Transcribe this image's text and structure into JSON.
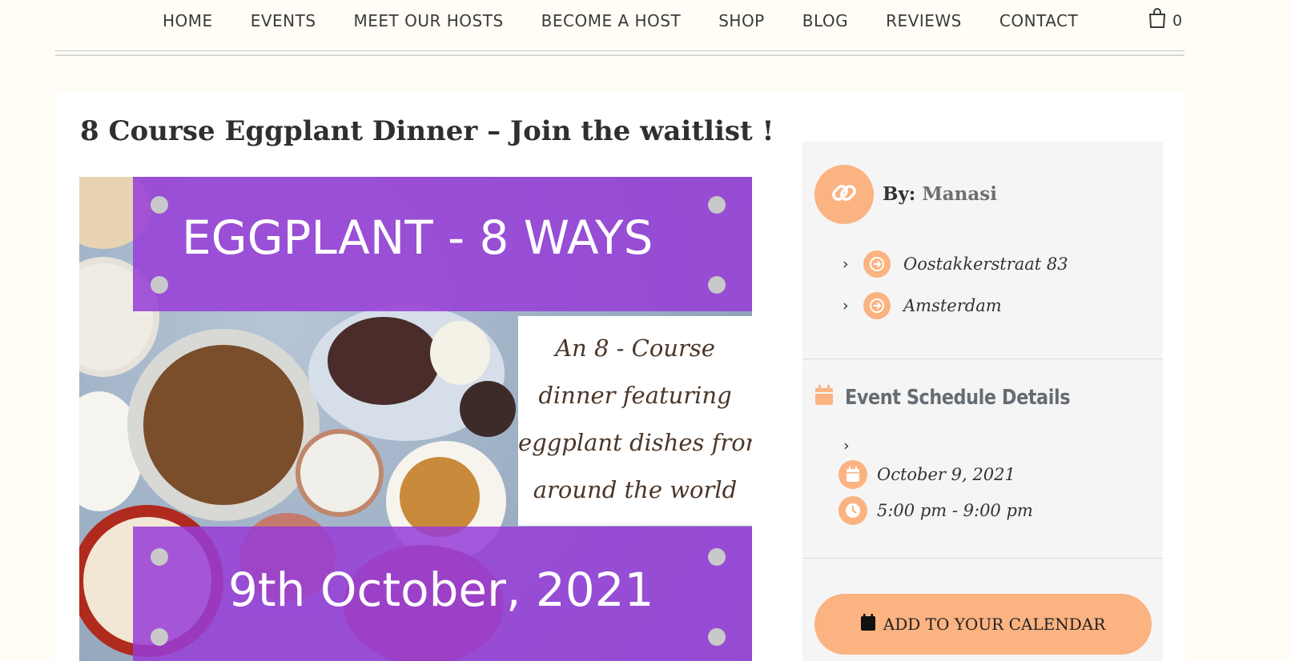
{
  "nav": {
    "items": [
      "HOME",
      "EVENTS",
      "MEET OUR HOSTS",
      "BECOME A HOST",
      "SHOP",
      "BLOG",
      "REVIEWS",
      "CONTACT"
    ],
    "cart_count": "0"
  },
  "event": {
    "title": "8 Course Eggplant Dinner – Join the waitlist !"
  },
  "poster": {
    "headline": "EGGPLANT - 8 WAYS",
    "script_lines": [
      "An 8 - Course",
      "dinner featuring",
      "eggplant dishes from",
      "around the world"
    ],
    "date": "9th October, 2021",
    "band_color": "#9b3fd6"
  },
  "sidebar": {
    "by_label": "By:",
    "host_name": "Manasi",
    "location": [
      "Oostakkerstraat 83",
      "Amsterdam"
    ],
    "schedule_title": "Event Schedule Details",
    "date": "October 9, 2021",
    "time": "5:00 pm - 9:00 pm",
    "calendar_button": "ADD TO YOUR CALENDAR"
  },
  "colors": {
    "accent": "#fbb381",
    "background": "#fffdf5",
    "sidebar_bg": "#f5f5f5",
    "heading_gray": "#666c73"
  },
  "icons": {
    "cart": "shopping-bag-icon",
    "host": "link-icon",
    "location": "arrow-right-circle-icon",
    "schedule": "calendar-icon",
    "time": "clock-icon"
  }
}
